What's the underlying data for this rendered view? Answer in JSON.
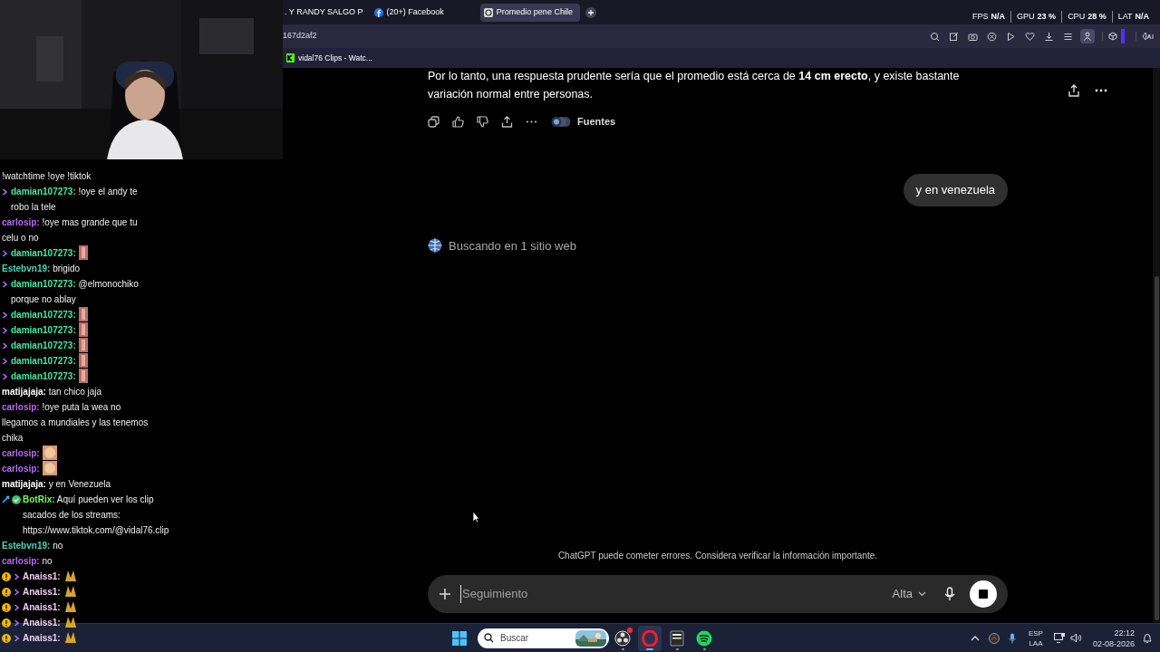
{
  "stream": {
    "chat": [
      {
        "kind": "plain",
        "text": "!watchtime !oye !tiktok"
      },
      {
        "kind": "sub",
        "user": "damian107273:",
        "color": "#47e6a4",
        "text": "!oye el andy te robo la tele"
      },
      {
        "kind": "plain",
        "user": "carlosip:",
        "color": "#b46cf0",
        "text": "!oye mas grande que tu celu o no"
      },
      {
        "kind": "sub",
        "user": "damian107273:",
        "color": "#47e6a4",
        "emote": true
      },
      {
        "kind": "plain",
        "user": "Estebvn19:",
        "color": "#4fd1b8",
        "text": "brigido"
      },
      {
        "kind": "sub",
        "user": "damian107273:",
        "color": "#47e6a4",
        "text": "@elmonochiko porque no ablay"
      },
      {
        "kind": "sub",
        "user": "damian107273:",
        "color": "#47e6a4",
        "emote": true
      },
      {
        "kind": "sub",
        "user": "damian107273:",
        "color": "#47e6a4",
        "emote": true
      },
      {
        "kind": "sub",
        "user": "damian107273:",
        "color": "#47e6a4",
        "emote": true
      },
      {
        "kind": "sub",
        "user": "damian107273:",
        "color": "#47e6a4",
        "emote": true
      },
      {
        "kind": "sub",
        "user": "damian107273:",
        "color": "#47e6a4",
        "emote": true
      },
      {
        "kind": "plain",
        "user": "matijajaja:",
        "color": "#ffffff",
        "text": "tan chico jaja"
      },
      {
        "kind": "plain",
        "user": "carlosip:",
        "color": "#b46cf0",
        "text": "!oye puta la wea no llegamos a mundiales y las tenemos chika"
      },
      {
        "kind": "plain",
        "user": "carlosip:",
        "color": "#b46cf0",
        "emote": true
      },
      {
        "kind": "plain",
        "user": "carlosip:",
        "color": "#b46cf0",
        "emote": true
      },
      {
        "kind": "plain",
        "user": "matijajaja:",
        "color": "#ffffff",
        "text": "y en Venezuela"
      },
      {
        "kind": "bot",
        "user": "BotRix:",
        "color": "#7cf55a",
        "text": "Aquí pueden ver los clip sacados de los streams: https://www.tiktok.com/@vidal76.clip"
      },
      {
        "kind": "plain",
        "user": "Estebvn19:",
        "color": "#4fd1b8",
        "text": "no"
      },
      {
        "kind": "plain",
        "user": "carlosip:",
        "color": "#b46cf0",
        "text": "no"
      },
      {
        "kind": "gold",
        "user": "Anaiss1:",
        "color": "#f3cdf0",
        "emote": true
      },
      {
        "kind": "gold",
        "user": "Anaiss1:",
        "color": "#f3cdf0",
        "emote": true
      },
      {
        "kind": "gold",
        "user": "Anaiss1:",
        "color": "#f3cdf0",
        "emote": true
      },
      {
        "kind": "gold",
        "user": "Anaiss1:",
        "color": "#f3cdf0",
        "emote": true
      },
      {
        "kind": "gold",
        "user": "Anaiss1:",
        "color": "#f3cdf0",
        "emote": true
      }
    ]
  },
  "browser": {
    "tabs": [
      {
        "label": ". Y RANDY SALGO P",
        "selected": false
      },
      {
        "label": "(20+) Facebook",
        "selected": false
      },
      {
        "label": "Promedio pene Chile",
        "selected": true
      }
    ],
    "stats": [
      {
        "label": "FPS",
        "value": "N/A"
      },
      {
        "label": "GPU",
        "value": "23 %"
      },
      {
        "label": "CPU",
        "value": "28 %"
      },
      {
        "label": "LAT",
        "value": "N/A"
      }
    ],
    "address": "167d2af2",
    "bookmarks": [
      {
        "label": "vidal76 Clips - Watc..."
      }
    ]
  },
  "conversation": {
    "answer_tail": "Por lo tanto, una respuesta prudente sería que el promedio está cerca de **14 cm erecto**, y existe bastante variación normal entre personas.",
    "sources_label": "Fuentes",
    "user_message": "y en venezuela",
    "status": "Buscando en 1 sitio web",
    "disclaimer": "ChatGPT puede cometer errores. Considera verificar la información importante.",
    "composer": {
      "placeholder": "Seguimiento",
      "model": "Alta"
    }
  },
  "taskbar": {
    "search_placeholder": "Buscar",
    "apps": [
      {
        "kind": "obs",
        "active": false,
        "notify": true
      },
      {
        "kind": "opera",
        "active": true,
        "notify": false
      },
      {
        "kind": "epic",
        "active": false,
        "notify": false
      },
      {
        "kind": "spotify",
        "active": false,
        "notify": false
      }
    ],
    "tray": {
      "language": "ESP",
      "layout": "LAA",
      "time": "22:12",
      "date": "02-08-2026"
    }
  }
}
